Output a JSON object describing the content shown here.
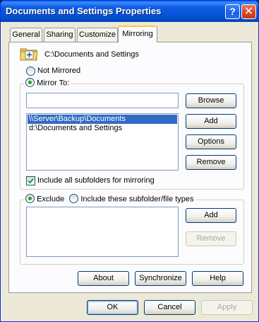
{
  "window": {
    "title": "Documents and Settings Properties",
    "help_glyph": "?",
    "close_glyph": "✕"
  },
  "tabs": [
    {
      "label": "General",
      "active": false
    },
    {
      "label": "Sharing",
      "active": false
    },
    {
      "label": "Customize",
      "active": false
    },
    {
      "label": "Mirroring",
      "active": true
    }
  ],
  "folder": {
    "icon": "folder-plus-icon",
    "path": "C:\\Documents and Settings"
  },
  "mirror_mode": {
    "not_mirrored_label": "Not Mirrored",
    "mirror_to_label": "Mirror To:",
    "selected": "mirror_to"
  },
  "mirror_to": {
    "input_value": "",
    "targets": [
      {
        "path": "\\\\Server\\Backup\\Documents",
        "selected": true
      },
      {
        "path": "d:\\Documents and Settings",
        "selected": false
      }
    ],
    "browse_label": "Browse",
    "add_label": "Add",
    "options_label": "Options",
    "remove_label": "Remove",
    "include_subfolders_label": "Include all subfolders for mirroring",
    "include_subfolders_checked": true
  },
  "filter": {
    "exclude_label": "Exclude",
    "include_label": "Include these subfolder/file types",
    "selected": "exclude",
    "items": [],
    "add_label": "Add",
    "remove_label": "Remove"
  },
  "panel_buttons": {
    "about_label": "About",
    "synchronize_label": "Synchronize",
    "help_label": "Help"
  },
  "dialog_buttons": {
    "ok_label": "OK",
    "cancel_label": "Cancel",
    "apply_label": "Apply"
  }
}
